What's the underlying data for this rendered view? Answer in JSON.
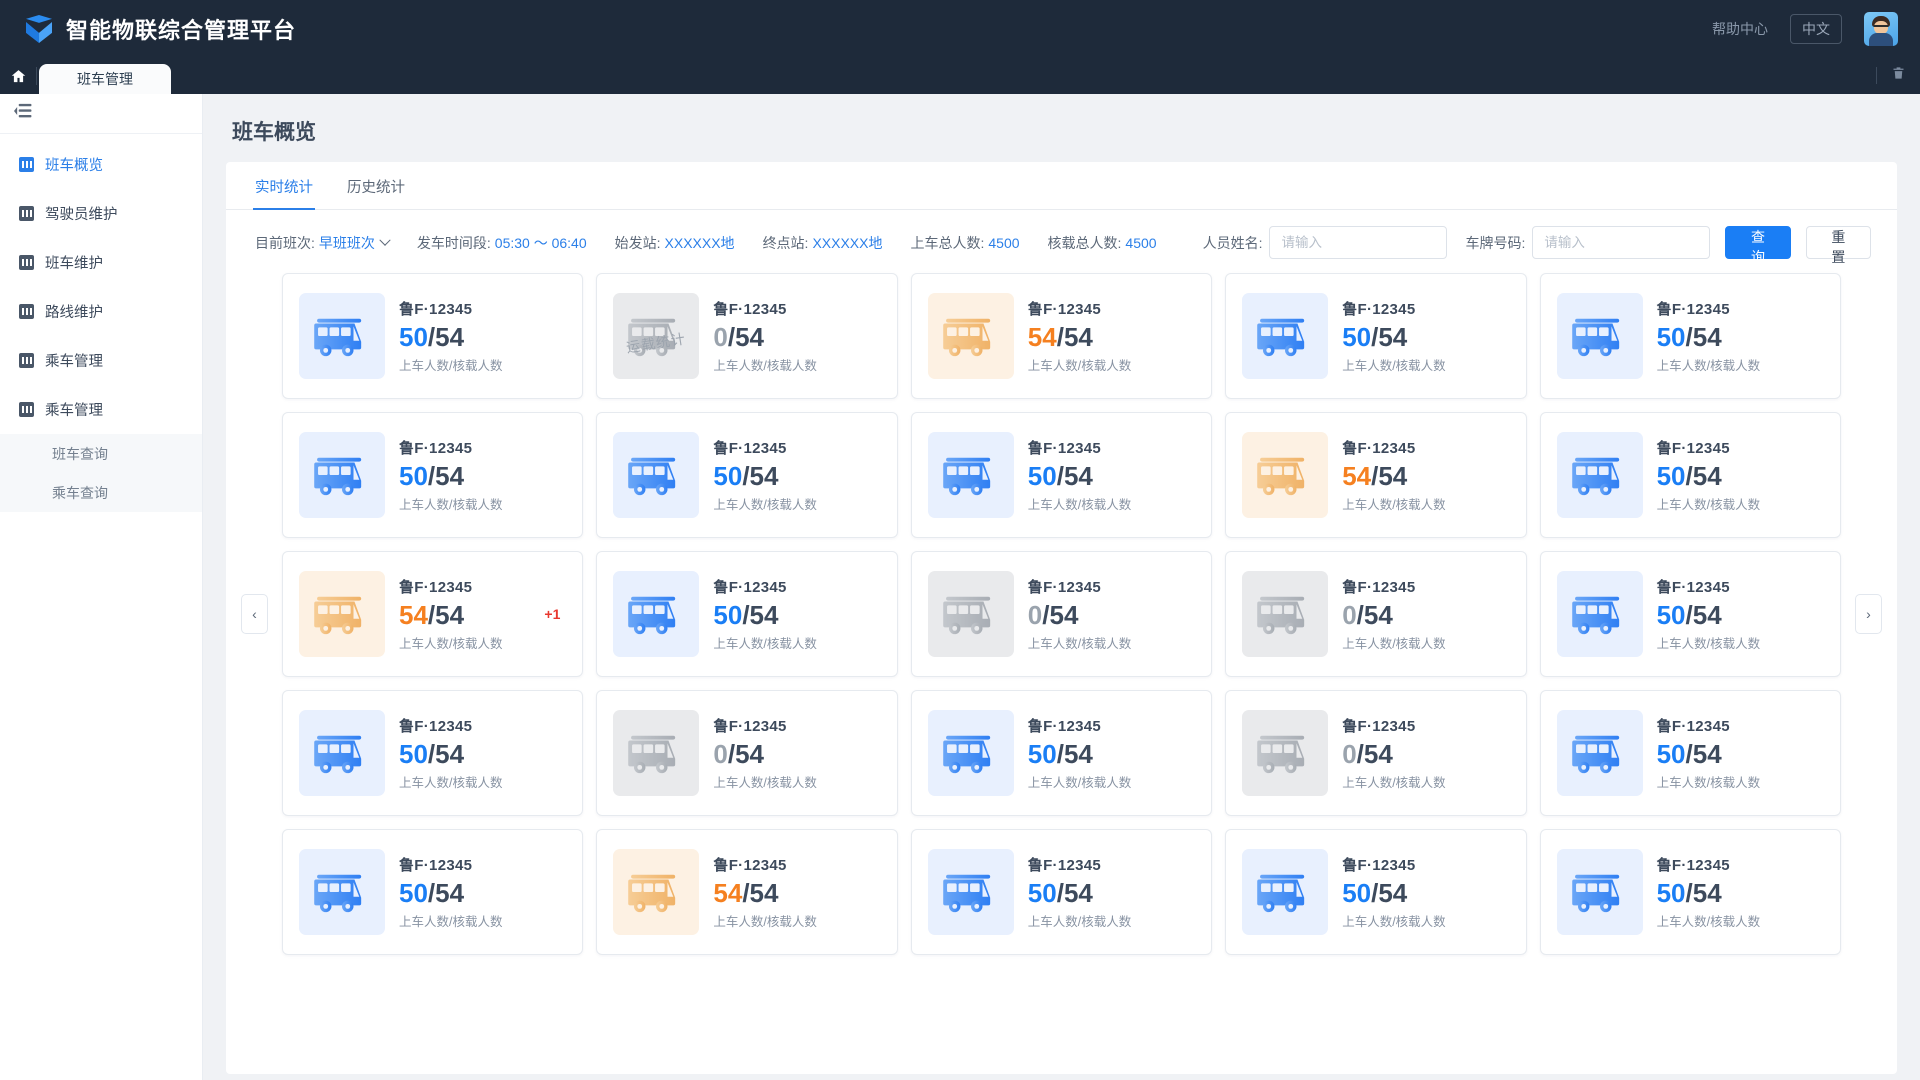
{
  "header": {
    "brand_title": "智能物联综合管理平台",
    "help_label": "帮助中心",
    "lang_label": "中文"
  },
  "tabstrip": {
    "tabs": [
      {
        "label": "班车管理"
      }
    ]
  },
  "sidebar": {
    "items": [
      {
        "label": "班车概览",
        "active": true
      },
      {
        "label": "驾驶员维护",
        "active": false
      },
      {
        "label": "班车维护",
        "active": false
      },
      {
        "label": "路线维护",
        "active": false
      },
      {
        "label": "乘车管理",
        "active": false
      },
      {
        "label": "乘车管理",
        "active": false
      }
    ],
    "subitems": [
      {
        "label": "班车查询"
      },
      {
        "label": "乘车查询"
      }
    ]
  },
  "main": {
    "page_title": "班车概览",
    "tabs": [
      {
        "label": "实时统计",
        "active": true
      },
      {
        "label": "历史统计",
        "active": false
      }
    ],
    "filters": [
      {
        "label": "目前班次:",
        "value": "早班班次",
        "caret": true
      },
      {
        "label": "发车时间段:",
        "value": "05:30 ～ 06:40",
        "caret": false
      },
      {
        "label": "始发站:",
        "value": "XXXXXX地",
        "caret": false
      },
      {
        "label": "终点站:",
        "value": "XXXXXX地",
        "caret": false
      },
      {
        "label": "上车总人数:",
        "value": "4500",
        "caret": false
      },
      {
        "label": "核载总人数:",
        "value": "4500",
        "caret": false
      }
    ],
    "search": {
      "name_label": "人员姓名:",
      "name_value": "",
      "name_placeholder": "请输入",
      "plate_label": "车牌号码:",
      "plate_value": "",
      "plate_placeholder": "请输入",
      "submit_label": "查询",
      "reset_label": "重置"
    },
    "card_caption": "上车人数/核载人数",
    "watermark_text": "运载统计",
    "nav": {
      "prev": "‹",
      "next": "›"
    },
    "cards": [
      {
        "plate": "鲁F·12345",
        "current": "50",
        "capacity": "54",
        "state": "blue",
        "badge": ""
      },
      {
        "plate": "鲁F·12345",
        "current": "0",
        "capacity": "54",
        "state": "gray",
        "badge": "",
        "watermark": true
      },
      {
        "plate": "鲁F·12345",
        "current": "54",
        "capacity": "54",
        "state": "orange",
        "badge": ""
      },
      {
        "plate": "鲁F·12345",
        "current": "50",
        "capacity": "54",
        "state": "blue",
        "badge": ""
      },
      {
        "plate": "鲁F·12345",
        "current": "50",
        "capacity": "54",
        "state": "blue",
        "badge": ""
      },
      {
        "plate": "鲁F·12345",
        "current": "50",
        "capacity": "54",
        "state": "blue",
        "badge": ""
      },
      {
        "plate": "鲁F·12345",
        "current": "50",
        "capacity": "54",
        "state": "blue",
        "badge": ""
      },
      {
        "plate": "鲁F·12345",
        "current": "50",
        "capacity": "54",
        "state": "blue",
        "badge": ""
      },
      {
        "plate": "鲁F·12345",
        "current": "54",
        "capacity": "54",
        "state": "orange",
        "badge": ""
      },
      {
        "plate": "鲁F·12345",
        "current": "50",
        "capacity": "54",
        "state": "blue",
        "badge": ""
      },
      {
        "plate": "鲁F·12345",
        "current": "54",
        "capacity": "54",
        "state": "orange",
        "badge": "+1"
      },
      {
        "plate": "鲁F·12345",
        "current": "50",
        "capacity": "54",
        "state": "blue",
        "badge": ""
      },
      {
        "plate": "鲁F·12345",
        "current": "0",
        "capacity": "54",
        "state": "gray",
        "badge": ""
      },
      {
        "plate": "鲁F·12345",
        "current": "0",
        "capacity": "54",
        "state": "gray",
        "badge": ""
      },
      {
        "plate": "鲁F·12345",
        "current": "50",
        "capacity": "54",
        "state": "blue",
        "badge": ""
      },
      {
        "plate": "鲁F·12345",
        "current": "50",
        "capacity": "54",
        "state": "blue",
        "badge": ""
      },
      {
        "plate": "鲁F·12345",
        "current": "0",
        "capacity": "54",
        "state": "gray",
        "badge": ""
      },
      {
        "plate": "鲁F·12345",
        "current": "50",
        "capacity": "54",
        "state": "blue",
        "badge": ""
      },
      {
        "plate": "鲁F·12345",
        "current": "0",
        "capacity": "54",
        "state": "gray",
        "badge": ""
      },
      {
        "plate": "鲁F·12345",
        "current": "50",
        "capacity": "54",
        "state": "blue",
        "badge": ""
      },
      {
        "plate": "鲁F·12345",
        "current": "50",
        "capacity": "54",
        "state": "blue",
        "badge": ""
      },
      {
        "plate": "鲁F·12345",
        "current": "54",
        "capacity": "54",
        "state": "orange",
        "badge": ""
      },
      {
        "plate": "鲁F·12345",
        "current": "50",
        "capacity": "54",
        "state": "blue",
        "badge": ""
      },
      {
        "plate": "鲁F·12345",
        "current": "50",
        "capacity": "54",
        "state": "blue",
        "badge": ""
      },
      {
        "plate": "鲁F·12345",
        "current": "50",
        "capacity": "54",
        "state": "blue",
        "badge": ""
      }
    ]
  },
  "colors": {
    "header_bg": "#1e2a3a",
    "accent": "#2b7fe8",
    "primary_button": "#1a7ef5",
    "warn": "#f58020",
    "danger": "#e8382f",
    "muted": "#9aa3ad"
  }
}
